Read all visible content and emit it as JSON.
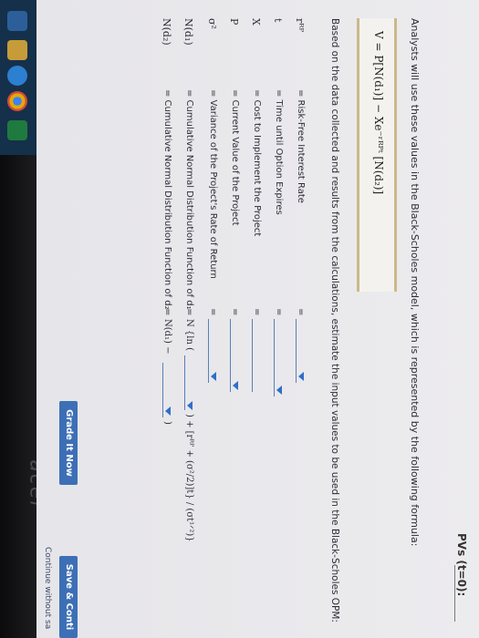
{
  "header": {
    "pvs_label": "PVs (t=0):"
  },
  "intro": {
    "text": "Analysts will use these values in the Black-Scholes model, which is represented by the following formula:"
  },
  "formula": {
    "text": "V = P[N(d₁)] − Xe⁻ʳᴿᴾᵗ [N(d₂)]"
  },
  "prompt": {
    "text": "Based on the data collected and results from the calculations, estimate the input values to be used in the Black-Scholes OPM:"
  },
  "inputs": [
    {
      "symbol": "rᴿᴾ",
      "desc": "= Risk-Free Interest Rate",
      "eq": "="
    },
    {
      "symbol": "t",
      "desc": "= Time until Option Expires",
      "eq": "="
    },
    {
      "symbol": "X",
      "desc": "= Cost to Implement the Project",
      "eq": "="
    },
    {
      "symbol": "P",
      "desc": "= Current Value of the Project",
      "eq": "="
    },
    {
      "symbol": "σ²",
      "desc": "= Variance of the Project's Rate of Return",
      "eq": "="
    },
    {
      "symbol": "N(d₁)",
      "desc": "= Cumulative Normal Distribution Function of d₁",
      "eq": "=",
      "prefix": "N {ln (",
      "suffix": ") + [rᴿᴾ + (σ²/2)]t} / (σt¹ᐟ²)}"
    },
    {
      "symbol": "N(d₂)",
      "desc": "= Cumulative Normal Distribution Function of d₂",
      "eq": "=",
      "prefix": "N(d₁) −",
      "suffix": ")"
    }
  ],
  "buttons": {
    "grade": "Grade It Now",
    "save": "Save & Conti"
  },
  "footer": {
    "continue_text": "Continue without sa"
  },
  "device": {
    "brand": "acer"
  },
  "colors": {
    "accent_blue": "#2f6fc8",
    "formula_border": "#cbb98a",
    "button_blue": "#3d6fb6"
  }
}
